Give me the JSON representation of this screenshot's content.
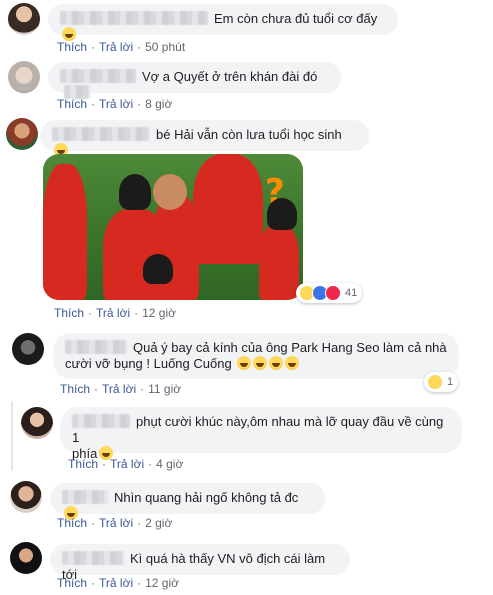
{
  "comments": [
    {
      "text": "Em còn chưa đủ tuổi cơ đấy",
      "like": "Thích",
      "reply": "Trả lời",
      "time": "50 phút"
    },
    {
      "text": "Vợ a Quyết ở trên khán đài đó",
      "like": "Thích",
      "reply": "Trả lời",
      "time": "8 giờ"
    },
    {
      "text": "bé Hải vẫn còn lưa tuổi học sinh",
      "like": "Thích",
      "reply": "Trả lời",
      "time": "12 giờ",
      "reaction_count": "41"
    },
    {
      "text_line1": "Quả ý bay cả kính của ông Park Hang Seo làm cả nhà",
      "text_line2": "cười vỡ bụng ! Luống Cuống",
      "like": "Thích",
      "reply": "Trả lời",
      "time": "11 giờ",
      "reaction_count": "1"
    },
    {
      "text_line1": "phụt cười khúc này,ôm nhau mà lỡ quay đầu về cùng 1",
      "text_line2": "phía",
      "like": "Thích",
      "reply": "Trả lời",
      "time": "4 giờ"
    },
    {
      "text": "Nhìn quang hải ngố không tả đc",
      "like": "Thích",
      "reply": "Trả lời",
      "time": "2 giờ"
    },
    {
      "text": "Kì quá hà thấy VN vô địch cái làm tới",
      "like": "Thích",
      "reply": "Trả lời",
      "time": "12 giờ"
    }
  ],
  "colors": {
    "link": "#385898",
    "bubble": "#f2f3f5",
    "meta": "#606770"
  },
  "icons": [
    "haha-emoji",
    "like-reaction",
    "love-reaction"
  ]
}
